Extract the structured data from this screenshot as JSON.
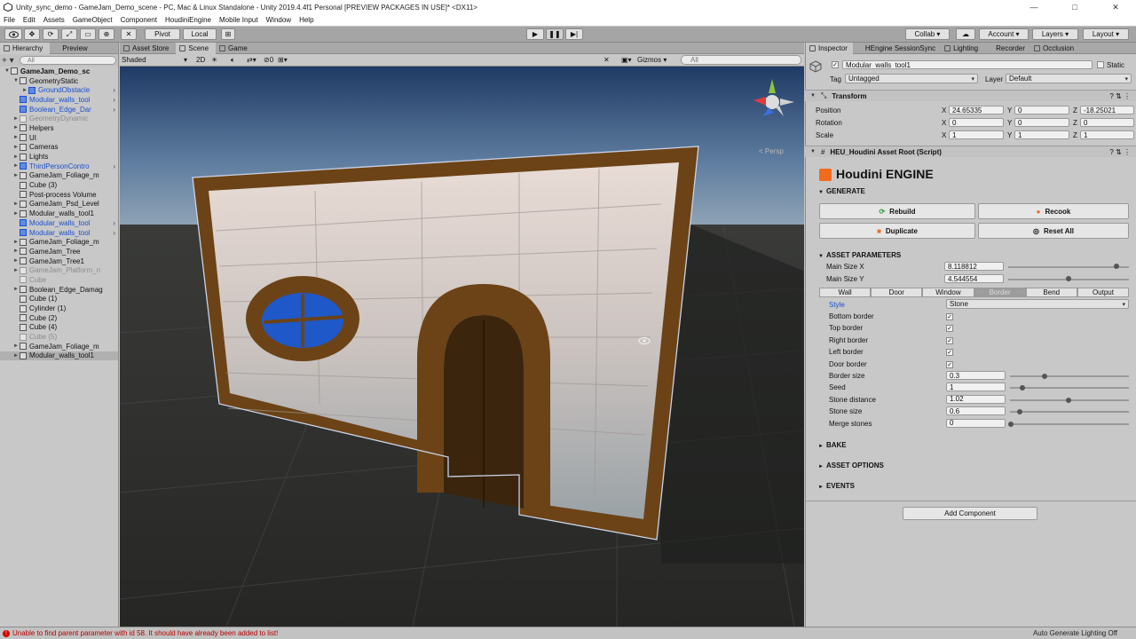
{
  "window": {
    "title": "Unity_sync_demo - GameJam_Demo_scene - PC, Mac & Linux Standalone - Unity 2019.4.4f1 Personal [PREVIEW PACKAGES IN USE]* <DX11>",
    "controls": [
      "—",
      "□",
      "✕"
    ]
  },
  "menu": [
    "File",
    "Edit",
    "Assets",
    "GameObject",
    "Component",
    "HoudiniEngine",
    "Mobile Input",
    "Window",
    "Help"
  ],
  "toolbar": {
    "pivot": "Pivot",
    "local": "Local",
    "collab": "Collab ▾",
    "account": "Account",
    "layers": "Layers",
    "layout": "Layout"
  },
  "hierarchy": {
    "tabs": [
      "Hierarchy",
      "Preview"
    ],
    "search_placeholder": "All",
    "items": [
      {
        "label": "GameJam_Demo_sc",
        "style": "bold",
        "indent": 0,
        "arrow": "▼"
      },
      {
        "label": "GeometryStatic",
        "style": "normal",
        "indent": 1,
        "arrow": "▼"
      },
      {
        "label": "GroundObstacle",
        "style": "blue",
        "indent": 2,
        "arrow": "►",
        "chev": true
      },
      {
        "label": "Modular_walls_tool",
        "style": "blue",
        "indent": 1,
        "arrow": "",
        "chev": true
      },
      {
        "label": "Boolean_Edge_Dar",
        "style": "blue",
        "indent": 1,
        "arrow": "",
        "chev": true
      },
      {
        "label": "GeometryDynamic",
        "style": "gray",
        "indent": 1,
        "arrow": "►"
      },
      {
        "label": "Helpers",
        "style": "normal",
        "indent": 1,
        "arrow": "►"
      },
      {
        "label": "UI",
        "style": "normal",
        "indent": 1,
        "arrow": "►"
      },
      {
        "label": "Cameras",
        "style": "normal",
        "indent": 1,
        "arrow": "►"
      },
      {
        "label": "Lights",
        "style": "normal",
        "indent": 1,
        "arrow": "►"
      },
      {
        "label": "ThirdPersonContro",
        "style": "blue",
        "indent": 1,
        "arrow": "►",
        "chev": true
      },
      {
        "label": "GameJam_Foliage_m",
        "style": "normal",
        "indent": 1,
        "arrow": "►"
      },
      {
        "label": "Cube (3)",
        "style": "normal",
        "indent": 1,
        "arrow": ""
      },
      {
        "label": "Post-process Volume",
        "style": "normal",
        "indent": 1,
        "arrow": ""
      },
      {
        "label": "GameJam_Psd_Level",
        "style": "normal",
        "indent": 1,
        "arrow": "►"
      },
      {
        "label": "Modular_walls_tool1",
        "style": "normal",
        "indent": 1,
        "arrow": "►"
      },
      {
        "label": "Modular_walls_tool",
        "style": "blue",
        "indent": 1,
        "arrow": "",
        "chev": true
      },
      {
        "label": "Modular_walls_tool",
        "style": "blue",
        "indent": 1,
        "arrow": "",
        "chev": true
      },
      {
        "label": "GameJam_Foliage_m",
        "style": "normal",
        "indent": 1,
        "arrow": "►"
      },
      {
        "label": "GameJam_Tree",
        "style": "normal",
        "indent": 1,
        "arrow": "►"
      },
      {
        "label": "GameJam_Tree1",
        "style": "normal",
        "indent": 1,
        "arrow": "►"
      },
      {
        "label": "GameJam_Platform_n",
        "style": "gray",
        "indent": 1,
        "arrow": "►"
      },
      {
        "label": "Cube",
        "style": "gray",
        "indent": 1,
        "arrow": ""
      },
      {
        "label": "Boolean_Edge_Damag",
        "style": "normal",
        "indent": 1,
        "arrow": "►"
      },
      {
        "label": "Cube (1)",
        "style": "normal",
        "indent": 1,
        "arrow": ""
      },
      {
        "label": "Cylinder (1)",
        "style": "normal",
        "indent": 1,
        "arrow": ""
      },
      {
        "label": "Cube (2)",
        "style": "normal",
        "indent": 1,
        "arrow": ""
      },
      {
        "label": "Cube (4)",
        "style": "normal",
        "indent": 1,
        "arrow": ""
      },
      {
        "label": "Cube (5)",
        "style": "gray",
        "indent": 1,
        "arrow": ""
      },
      {
        "label": "GameJam_Foliage_m",
        "style": "normal",
        "indent": 1,
        "arrow": "►"
      },
      {
        "label": "Modular_walls_tool1",
        "style": "sel",
        "indent": 1,
        "arrow": "►"
      }
    ]
  },
  "scene": {
    "tabs": [
      "Asset Store",
      "Scene",
      "Game"
    ],
    "shading": "Shaded",
    "mode_2d": "2D",
    "hidden_count": "0",
    "gizmos": "Gizmos",
    "search_placeholder": "All",
    "projection": "< Persp"
  },
  "inspector": {
    "tabs": [
      "Inspector",
      "HEngine SessionSync",
      "Lighting",
      "Recorder",
      "Occlusion"
    ],
    "object_name": "Modular_walls_tool1",
    "static_label": "Static",
    "tag_label": "Tag",
    "tag_value": "Untagged",
    "layer_label": "Layer",
    "layer_value": "Default",
    "transform": {
      "title": "Transform",
      "position_label": "Position",
      "rotation_label": "Rotation",
      "scale_label": "Scale",
      "position": {
        "x": "24.65335",
        "y": "0",
        "z": "-18.25021"
      },
      "rotation": {
        "x": "0",
        "y": "0",
        "z": "0"
      },
      "scale": {
        "x": "1",
        "y": "1",
        "z": "1"
      },
      "axis_x": "X",
      "axis_y": "Y",
      "axis_z": "Z"
    },
    "houdini": {
      "component_title": "HEU_Houdini Asset Root (Script)",
      "brand": "Houdini ENGINE",
      "generate": "GENERATE",
      "rebuild": "Rebuild",
      "recook": "Recook",
      "duplicate": "Duplicate",
      "reset_all": "Reset All",
      "asset_parameters": "ASSET PARAMETERS",
      "main_size_x_label": "Main Size X",
      "main_size_x": "8.118812",
      "main_size_x_slider": 0.9,
      "main_size_y_label": "Main Size Y",
      "main_size_y": "4.544554",
      "main_size_y_slider": 0.5,
      "param_tabs": [
        "Wall",
        "Door",
        "Window",
        "Border",
        "Bend",
        "Output"
      ],
      "active_tab": 3,
      "style_label": "Style",
      "style_value": "Stone",
      "checkboxes": [
        {
          "label": "Bottom border",
          "checked": true
        },
        {
          "label": "Top border",
          "checked": true
        },
        {
          "label": "Right border",
          "checked": true
        },
        {
          "label": "Left border",
          "checked": true
        },
        {
          "label": "Door border",
          "checked": true
        }
      ],
      "sliders": [
        {
          "label": "Border size",
          "value": "0.3",
          "fraction": 0.3
        },
        {
          "label": "Seed",
          "value": "1",
          "fraction": 0.1
        },
        {
          "label": "Stone distance",
          "value": "1.02",
          "fraction": 0.51
        },
        {
          "label": "Stone size",
          "value": "0.6",
          "fraction": 0.08
        },
        {
          "label": "Merge stones",
          "value": "0",
          "fraction": 0.0
        }
      ],
      "bake": "BAKE",
      "asset_options": "ASSET OPTIONS",
      "events": "EVENTS"
    },
    "add_component": "Add Component"
  },
  "status": {
    "error": "Unable to find parent parameter with id 58. It should have already been added to list!",
    "right": "Auto Generate Lighting Off"
  },
  "colors": {
    "accent_blue": "#1a4fd0",
    "houdini_orange": "#f26b1d",
    "error_red": "#b80000"
  }
}
